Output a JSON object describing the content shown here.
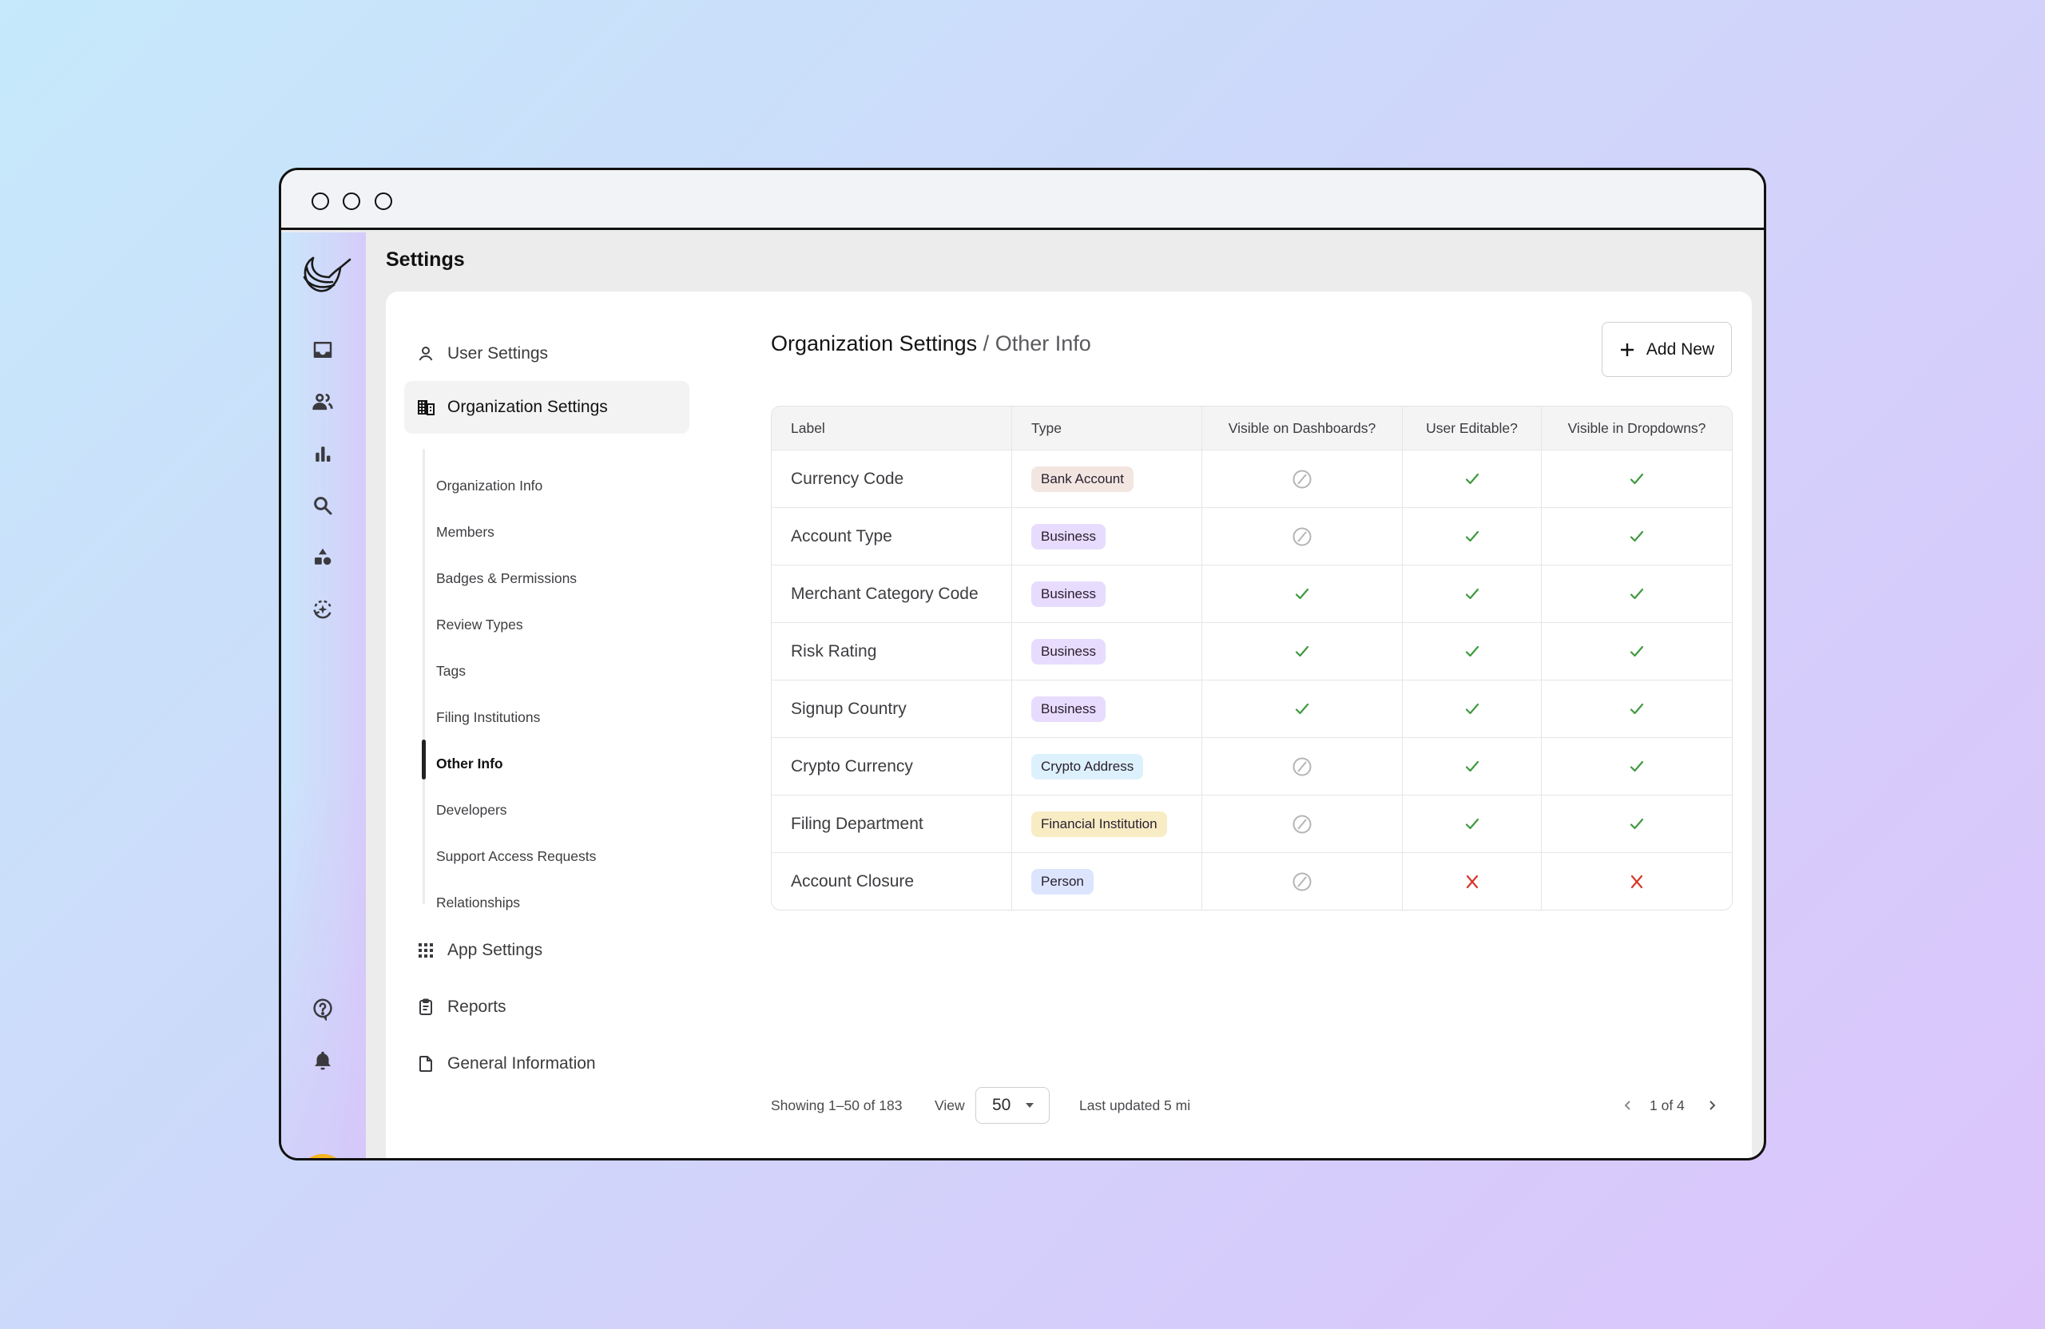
{
  "window": {
    "traffic_lights": [
      "close",
      "minimize",
      "zoom"
    ]
  },
  "rail": {
    "logo": "hummingbird-logo",
    "top_icons": [
      "inbox-icon",
      "users-icon",
      "bar-chart-icon",
      "search-icon",
      "shapes-icon",
      "ai-refresh-icon"
    ],
    "bottom_icons": [
      "help-icon",
      "bell-icon"
    ],
    "avatar": "user-avatar"
  },
  "header": {
    "title": "Settings"
  },
  "nav": {
    "user_settings": "User Settings",
    "organization_settings": "Organization Settings",
    "sub_items": [
      "Organization Info",
      "Members",
      "Badges & Permissions",
      "Review Types",
      "Tags",
      "Filing Institutions",
      "Other Info",
      "Developers",
      "Support Access Requests",
      "Relationships"
    ],
    "active_sub_item": "Other Info",
    "app_settings": "App Settings",
    "reports": "Reports",
    "general_information": "General Information"
  },
  "content": {
    "breadcrumb": {
      "parent": "Organization Settings",
      "separator": "/",
      "current": "Other Info"
    },
    "add_button": "Add New",
    "table": {
      "columns": [
        "Label",
        "Type",
        "Visible on Dashboards?",
        "User Editable?",
        "Visible in Dropdowns?"
      ],
      "rows": [
        {
          "label": "Currency Code",
          "type": "Bank Account",
          "type_color": "#f3e6e1",
          "dashboards": "disabled",
          "editable": "yes",
          "dropdowns": "yes"
        },
        {
          "label": "Account Type",
          "type": "Business",
          "type_color": "#e7dcfd",
          "dashboards": "disabled",
          "editable": "yes",
          "dropdowns": "yes"
        },
        {
          "label": "Merchant Category Code",
          "type": "Business",
          "type_color": "#e7dcfd",
          "dashboards": "yes",
          "editable": "yes",
          "dropdowns": "yes"
        },
        {
          "label": "Risk Rating",
          "type": "Business",
          "type_color": "#e7dcfd",
          "dashboards": "yes",
          "editable": "yes",
          "dropdowns": "yes"
        },
        {
          "label": "Signup Country",
          "type": "Business",
          "type_color": "#e7dcfd",
          "dashboards": "yes",
          "editable": "yes",
          "dropdowns": "yes"
        },
        {
          "label": "Crypto Currency",
          "type": "Crypto Address",
          "type_color": "#ddf1fc",
          "dashboards": "disabled",
          "editable": "yes",
          "dropdowns": "yes"
        },
        {
          "label": "Filing Department",
          "type": "Financial Institution",
          "type_color": "#f8ecc4",
          "dashboards": "disabled",
          "editable": "yes",
          "dropdowns": "yes"
        },
        {
          "label": "Account Closure",
          "type": "Person",
          "type_color": "#dce5fd",
          "dashboards": "disabled",
          "editable": "no",
          "dropdowns": "no"
        }
      ]
    },
    "footer": {
      "showing": "Showing 1–50 of 183",
      "view_label": "View",
      "view_value": "50",
      "last_updated": "Last updated 5 mi",
      "page_indicator": "1 of 4"
    }
  },
  "colors": {
    "check": "#3f9a3f",
    "cross": "#d6362a",
    "disabled": "#b5b5b8"
  }
}
